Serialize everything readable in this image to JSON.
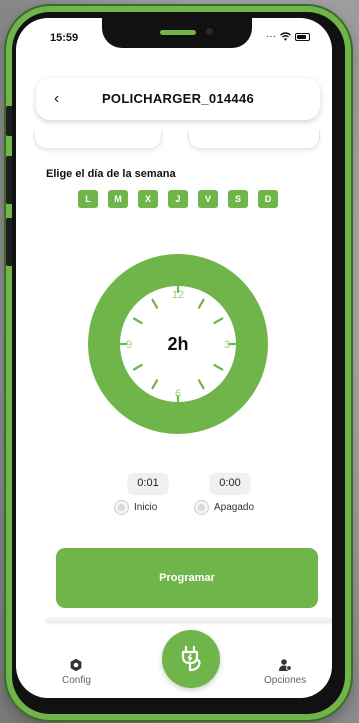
{
  "status": {
    "time": "15:59"
  },
  "header": {
    "title": "POLICHARGER_014446",
    "back_icon": "chevron-left-icon"
  },
  "schedule": {
    "day_label": "Elige el día de la semana",
    "days": [
      "L",
      "M",
      "X",
      "J",
      "V",
      "S",
      "D"
    ]
  },
  "clock": {
    "duration": "2h",
    "numbers": {
      "n12": "12",
      "n3": "3",
      "n6": "6",
      "n9": "9"
    }
  },
  "times": {
    "start_value": "0:01",
    "off_value": "0:00",
    "start_label": "Inicio",
    "off_label": "Apagado"
  },
  "actions": {
    "programar": "Programar"
  },
  "nav": {
    "config_label": "Config",
    "opciones_label": "Opciones",
    "center_icon": "charging-plug-icon"
  },
  "colors": {
    "accent": "#6fb54a",
    "phone_frame": "#6fb54a"
  }
}
